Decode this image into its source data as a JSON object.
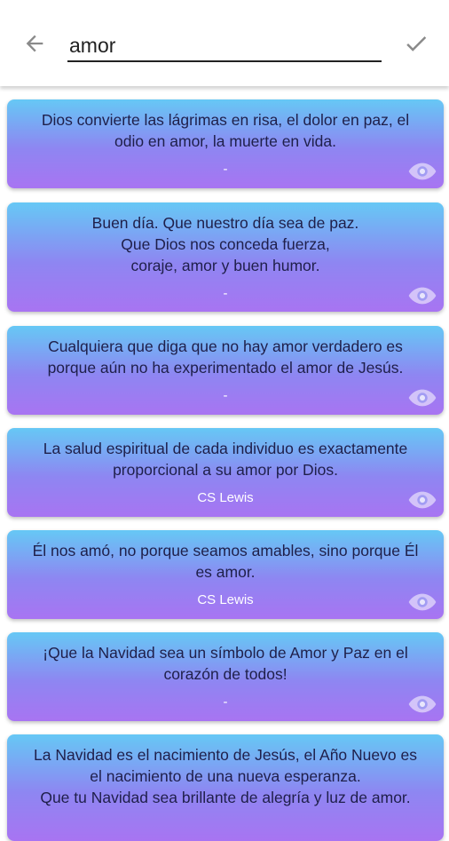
{
  "search": {
    "value": "amor"
  },
  "icons": {
    "back": "arrow-back-icon",
    "confirm": "check-icon",
    "view": "eye-icon"
  },
  "colors": {
    "gradient_top": "#66c8f5",
    "gradient_bottom": "#a874f2",
    "quote_text": "#1f1f4a"
  },
  "quotes": [
    {
      "text": "Dios convierte las lágrimas en risa, el dolor en paz, el\nodio en amor, la muerte en vida.",
      "author": "-"
    },
    {
      "text": "Buen día. Que nuestro día sea de paz.\nQue Dios nos conceda fuerza,\ncoraje, amor y buen humor.",
      "author": "-"
    },
    {
      "text": "Cualquiera que diga que no hay amor verdadero es\nporque aún no ha experimentado el amor de Jesús.",
      "author": "-"
    },
    {
      "text": "La salud espiritual de cada individuo es exactamente\nproporcional a su amor por Dios.",
      "author": "CS Lewis"
    },
    {
      "text": "Él nos amó, no porque seamos amables, sino porque Él\nes amor.",
      "author": "CS Lewis"
    },
    {
      "text": "¡Que la Navidad sea un símbolo de Amor y Paz en el\ncorazón de todos!",
      "author": "-"
    },
    {
      "text": "La Navidad es el nacimiento de Jesús, el Año Nuevo es\nel nacimiento de una nueva esperanza.\nQue tu Navidad sea brillante de alegría y luz de amor.",
      "author": ""
    }
  ]
}
